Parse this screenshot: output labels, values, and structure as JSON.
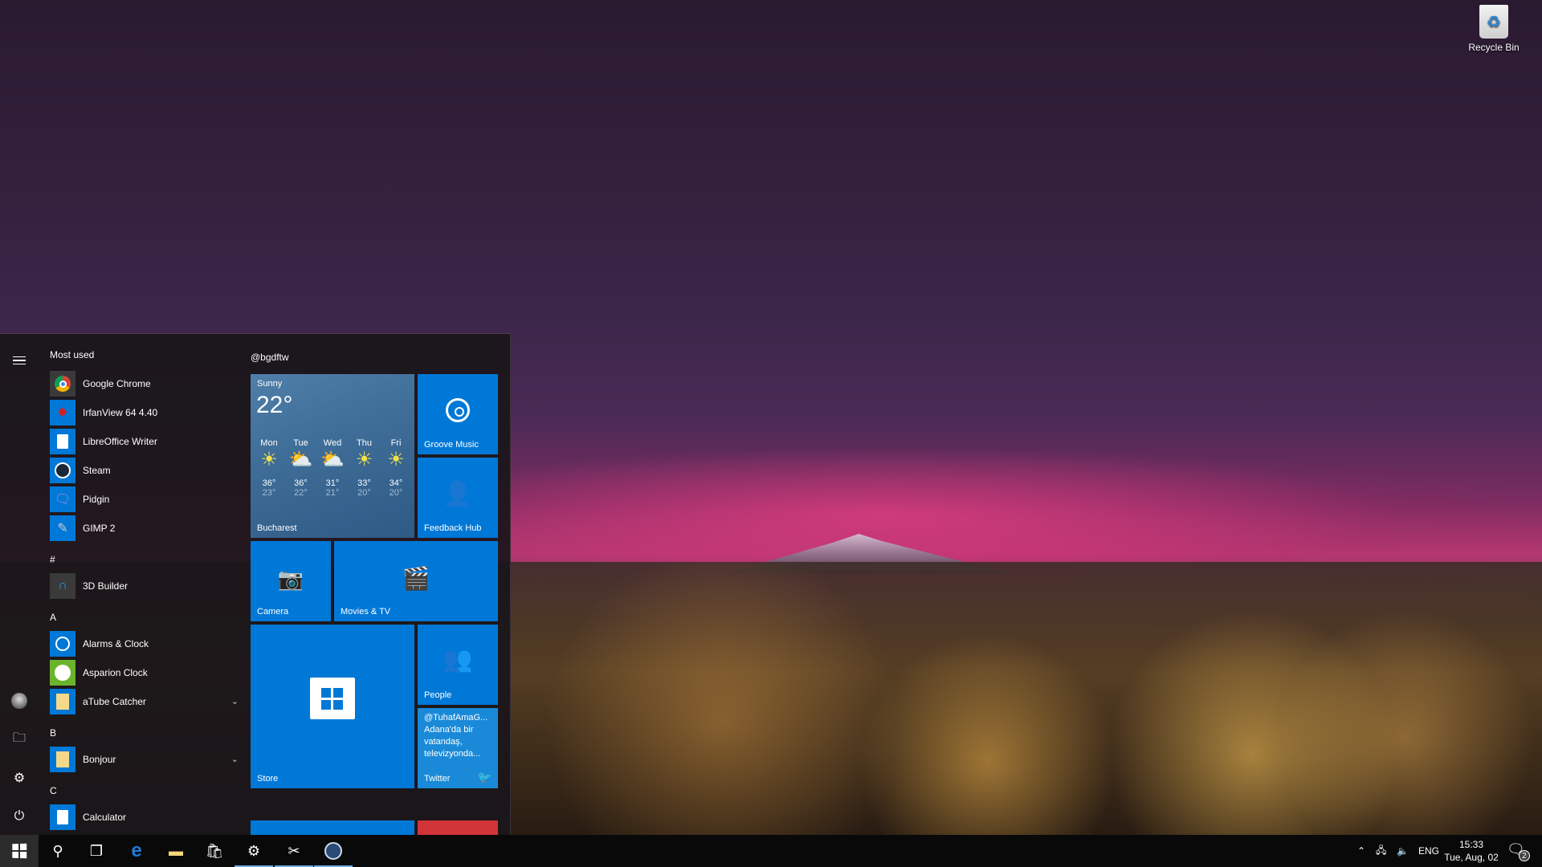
{
  "desktop": {
    "icons": [
      {
        "label": "Recycle Bin",
        "icon": "recycle-bin-icon"
      }
    ]
  },
  "start_menu": {
    "rail": {
      "menu_icon": "hamburger-icon",
      "user_icon": "user-avatar",
      "documents_icon": "file-explorer-icon",
      "settings_icon": "gear-icon",
      "power_icon": "power-icon"
    },
    "most_used_header": "Most used",
    "most_used": [
      {
        "name": "Google Chrome",
        "icon": "chrome-icon",
        "tile_color": "#3a3a3a"
      },
      {
        "name": "IrfanView 64 4.40",
        "icon": "irfanview-icon",
        "tile_color": "#0078d7"
      },
      {
        "name": "LibreOffice Writer",
        "icon": "libreoffice-writer-icon",
        "tile_color": "#0078d7"
      },
      {
        "name": "Steam",
        "icon": "steam-icon",
        "tile_color": "#0078d7"
      },
      {
        "name": "Pidgin",
        "icon": "pidgin-icon",
        "tile_color": "#0078d7"
      },
      {
        "name": "GIMP 2",
        "icon": "gimp-icon",
        "tile_color": "#0078d7"
      }
    ],
    "sections": [
      {
        "letter": "#",
        "apps": [
          {
            "name": "3D Builder",
            "icon": "3d-builder-icon",
            "tile_color": "#3a3a3a"
          }
        ]
      },
      {
        "letter": "A",
        "apps": [
          {
            "name": "Alarms & Clock",
            "icon": "alarm-clock-icon",
            "tile_color": "#0078d7"
          },
          {
            "name": "Asparion Clock",
            "icon": "clock-icon",
            "tile_color": "#6ab42d"
          },
          {
            "name": "aTube Catcher",
            "icon": "folder-icon",
            "tile_color": "#0078d7",
            "expandable": true
          }
        ]
      },
      {
        "letter": "B",
        "apps": [
          {
            "name": "Bonjour",
            "icon": "folder-icon",
            "tile_color": "#0078d7",
            "expandable": true
          }
        ]
      },
      {
        "letter": "C",
        "apps": [
          {
            "name": "Calculator",
            "icon": "calculator-icon",
            "tile_color": "#0078d7"
          }
        ]
      }
    ],
    "tiles_header": "@bgdftw",
    "tiles": {
      "weather": {
        "condition": "Sunny",
        "temperature": "22°",
        "location": "Bucharest",
        "forecast": [
          {
            "day": "Mon",
            "icon": "sun",
            "high": "36°",
            "low": "23°"
          },
          {
            "day": "Tue",
            "icon": "partly-cloudy",
            "high": "36°",
            "low": "22°"
          },
          {
            "day": "Wed",
            "icon": "partly-cloudy",
            "high": "31°",
            "low": "21°"
          },
          {
            "day": "Thu",
            "icon": "sun",
            "high": "33°",
            "low": "20°"
          },
          {
            "day": "Fri",
            "icon": "sun",
            "high": "34°",
            "low": "20°"
          }
        ]
      },
      "groove": {
        "label": "Groove Music"
      },
      "feedback": {
        "label": "Feedback Hub"
      },
      "camera": {
        "label": "Camera"
      },
      "movies": {
        "label": "Movies & TV"
      },
      "store": {
        "label": "Store"
      },
      "people": {
        "label": "People"
      },
      "twitter": {
        "label": "Twitter",
        "handle": "@TuhafAmaG...",
        "text": "Adana'da bir vatandaş, televizyonda..."
      }
    },
    "colors": {
      "tile_blue": "#0078d7",
      "twitter_blue": "#1a8ad8",
      "red_tile": "#d13438"
    }
  },
  "taskbar": {
    "pinned": [
      {
        "name": "Start",
        "icon": "windows-icon"
      },
      {
        "name": "Search",
        "icon": "search-icon"
      },
      {
        "name": "Task View",
        "icon": "task-view-icon"
      },
      {
        "name": "Microsoft Edge",
        "icon": "edge-icon"
      },
      {
        "name": "File Explorer",
        "icon": "folder-icon"
      },
      {
        "name": "Store",
        "icon": "store-icon"
      },
      {
        "name": "Settings",
        "icon": "gear-icon",
        "running": true
      },
      {
        "name": "Snipping app",
        "icon": "scissors-icon",
        "running": true
      },
      {
        "name": "Steam",
        "icon": "steam-icon",
        "running": true
      }
    ],
    "tray": {
      "language": "ENG",
      "time": "15:33",
      "date": "Tue, Aug, 02",
      "notification_count": "2"
    }
  }
}
